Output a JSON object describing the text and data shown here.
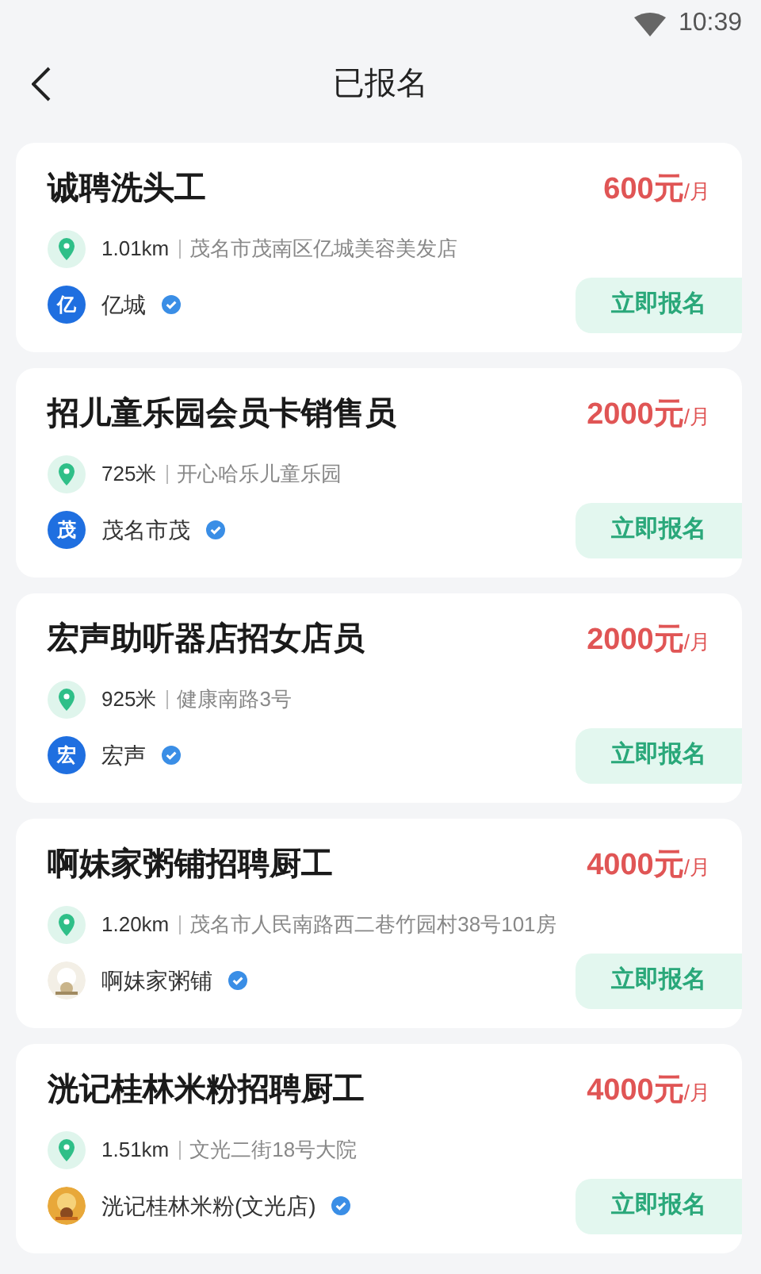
{
  "status_bar": {
    "time": "10:39"
  },
  "header": {
    "title": "已报名"
  },
  "jobs": [
    {
      "title": "诚聘洗头工",
      "salary": "600元",
      "unit": "/月",
      "distance": "1.01km",
      "address": "茂名市茂南区亿城美容美发店",
      "company": {
        "name": "亿城",
        "verified": true,
        "logo": {
          "kind": "letter",
          "text": "亿"
        }
      },
      "button": "立即报名"
    },
    {
      "title": "招儿童乐园会员卡销售员",
      "salary": "2000元",
      "unit": "/月",
      "distance": "725米",
      "address": "开心哈乐儿童乐园",
      "company": {
        "name": "茂名市茂",
        "verified": true,
        "logo": {
          "kind": "letter",
          "text": "茂"
        }
      },
      "button": "立即报名"
    },
    {
      "title": "宏声助听器店招女店员",
      "salary": "2000元",
      "unit": "/月",
      "distance": "925米",
      "address": "健康南路3号",
      "company": {
        "name": "宏声",
        "verified": true,
        "logo": {
          "kind": "letter",
          "text": "宏"
        }
      },
      "button": "立即报名"
    },
    {
      "title": "啊妹家粥铺招聘厨工",
      "salary": "4000元",
      "unit": "/月",
      "distance": "1.20km",
      "address": "茂名市人民南路西二巷竹园村38号101房",
      "company": {
        "name": "啊妹家粥铺",
        "verified": true
      },
      "button": "立即报名"
    },
    {
      "title": "洸记桂林米粉招聘厨工",
      "salary": "4000元",
      "unit": "/月",
      "distance": "1.51km",
      "address": "文光二街18号大院",
      "company": {
        "name": "洸记桂林米粉(文光店)",
        "verified": true
      },
      "button": "立即报名"
    }
  ]
}
